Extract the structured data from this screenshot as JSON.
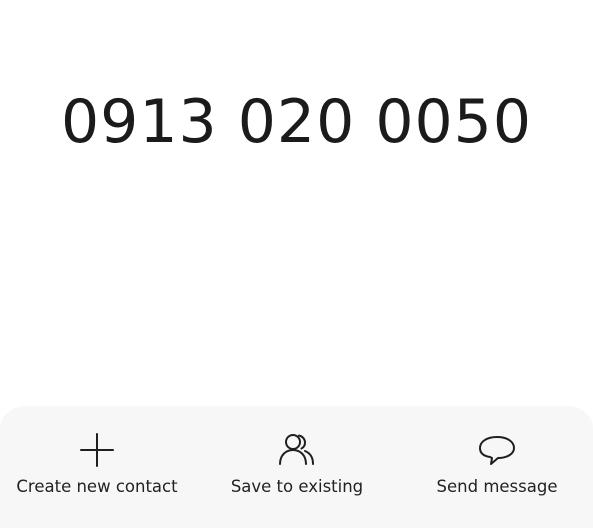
{
  "dialer": {
    "number": "0913 020 0050"
  },
  "actions": [
    {
      "label": "Create new contact",
      "icon": "plus-icon"
    },
    {
      "label": "Save to existing",
      "icon": "contacts-icon"
    },
    {
      "label": "Send message",
      "icon": "chat-bubble-icon"
    }
  ]
}
